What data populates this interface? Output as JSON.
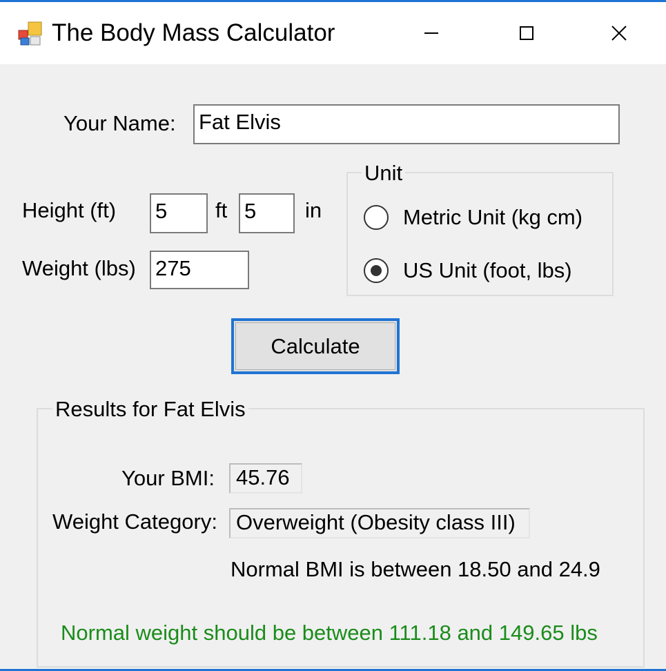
{
  "window": {
    "title": "The Body Mass Calculator",
    "accent_color": "#1f74d4",
    "icons": {
      "app": "app-icon",
      "minimize": "minimize-icon",
      "maximize": "maximize-icon",
      "close": "close-icon"
    }
  },
  "form": {
    "name_label": "Your Name:",
    "name_value": "Fat Elvis",
    "height_label": "Height (ft)",
    "height_ft_value": "5",
    "ft_unit": "ft",
    "height_in_value": "5",
    "in_unit": "in",
    "weight_label": "Weight (lbs)",
    "weight_value": "275"
  },
  "unit_group": {
    "title": "Unit",
    "options": [
      {
        "label": "Metric Unit (kg cm)",
        "selected": false
      },
      {
        "label": "US Unit (foot, lbs)",
        "selected": true
      }
    ]
  },
  "calculate_label": "Calculate",
  "results": {
    "title": "Results for Fat Elvis",
    "bmi_label": "Your BMI:",
    "bmi_value": "45.76",
    "category_label": "Weight Category:",
    "category_value": "Overweight (Obesity class III)",
    "normal_bmi_text": "Normal BMI is between 18.50 and 24.9",
    "normal_weight_text": "Normal weight should be between 111.18 and 149.65 lbs",
    "normal_weight_color": "#1a8c1a"
  }
}
